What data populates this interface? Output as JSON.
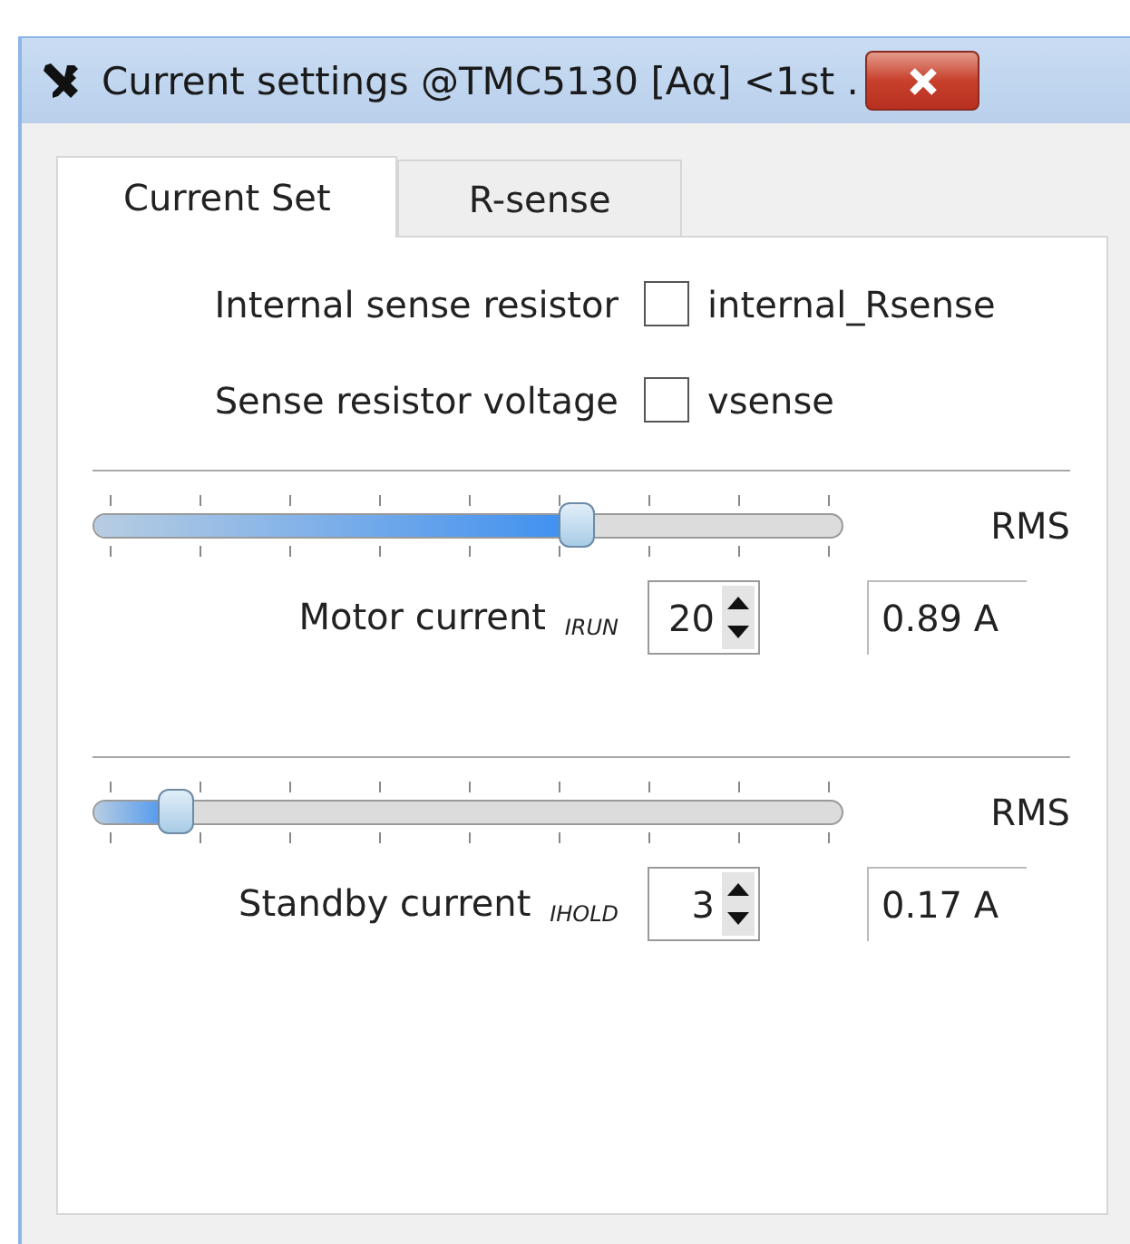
{
  "window": {
    "title": "Current settings @TMC5130 [Aα] <1st ."
  },
  "tabs": [
    {
      "label": "Current Set",
      "selected": true
    },
    {
      "label": "R-sense",
      "selected": false
    }
  ],
  "options": [
    {
      "label": "Internal sense resistor",
      "checked": false,
      "option": "internal_Rsense"
    },
    {
      "label": "Sense resistor voltage",
      "checked": false,
      "option": "vsense"
    }
  ],
  "currents": [
    {
      "level": 0.645,
      "unit": "RMS",
      "label": "Motor current $_{IRUN}$",
      "value": "20",
      "reading": "0.89 A"
    },
    {
      "level": 0.11,
      "unit": "RMS",
      "label": "Standby current $_{IHOLD}$",
      "value": "3",
      "reading": "0.17 A"
    }
  ]
}
